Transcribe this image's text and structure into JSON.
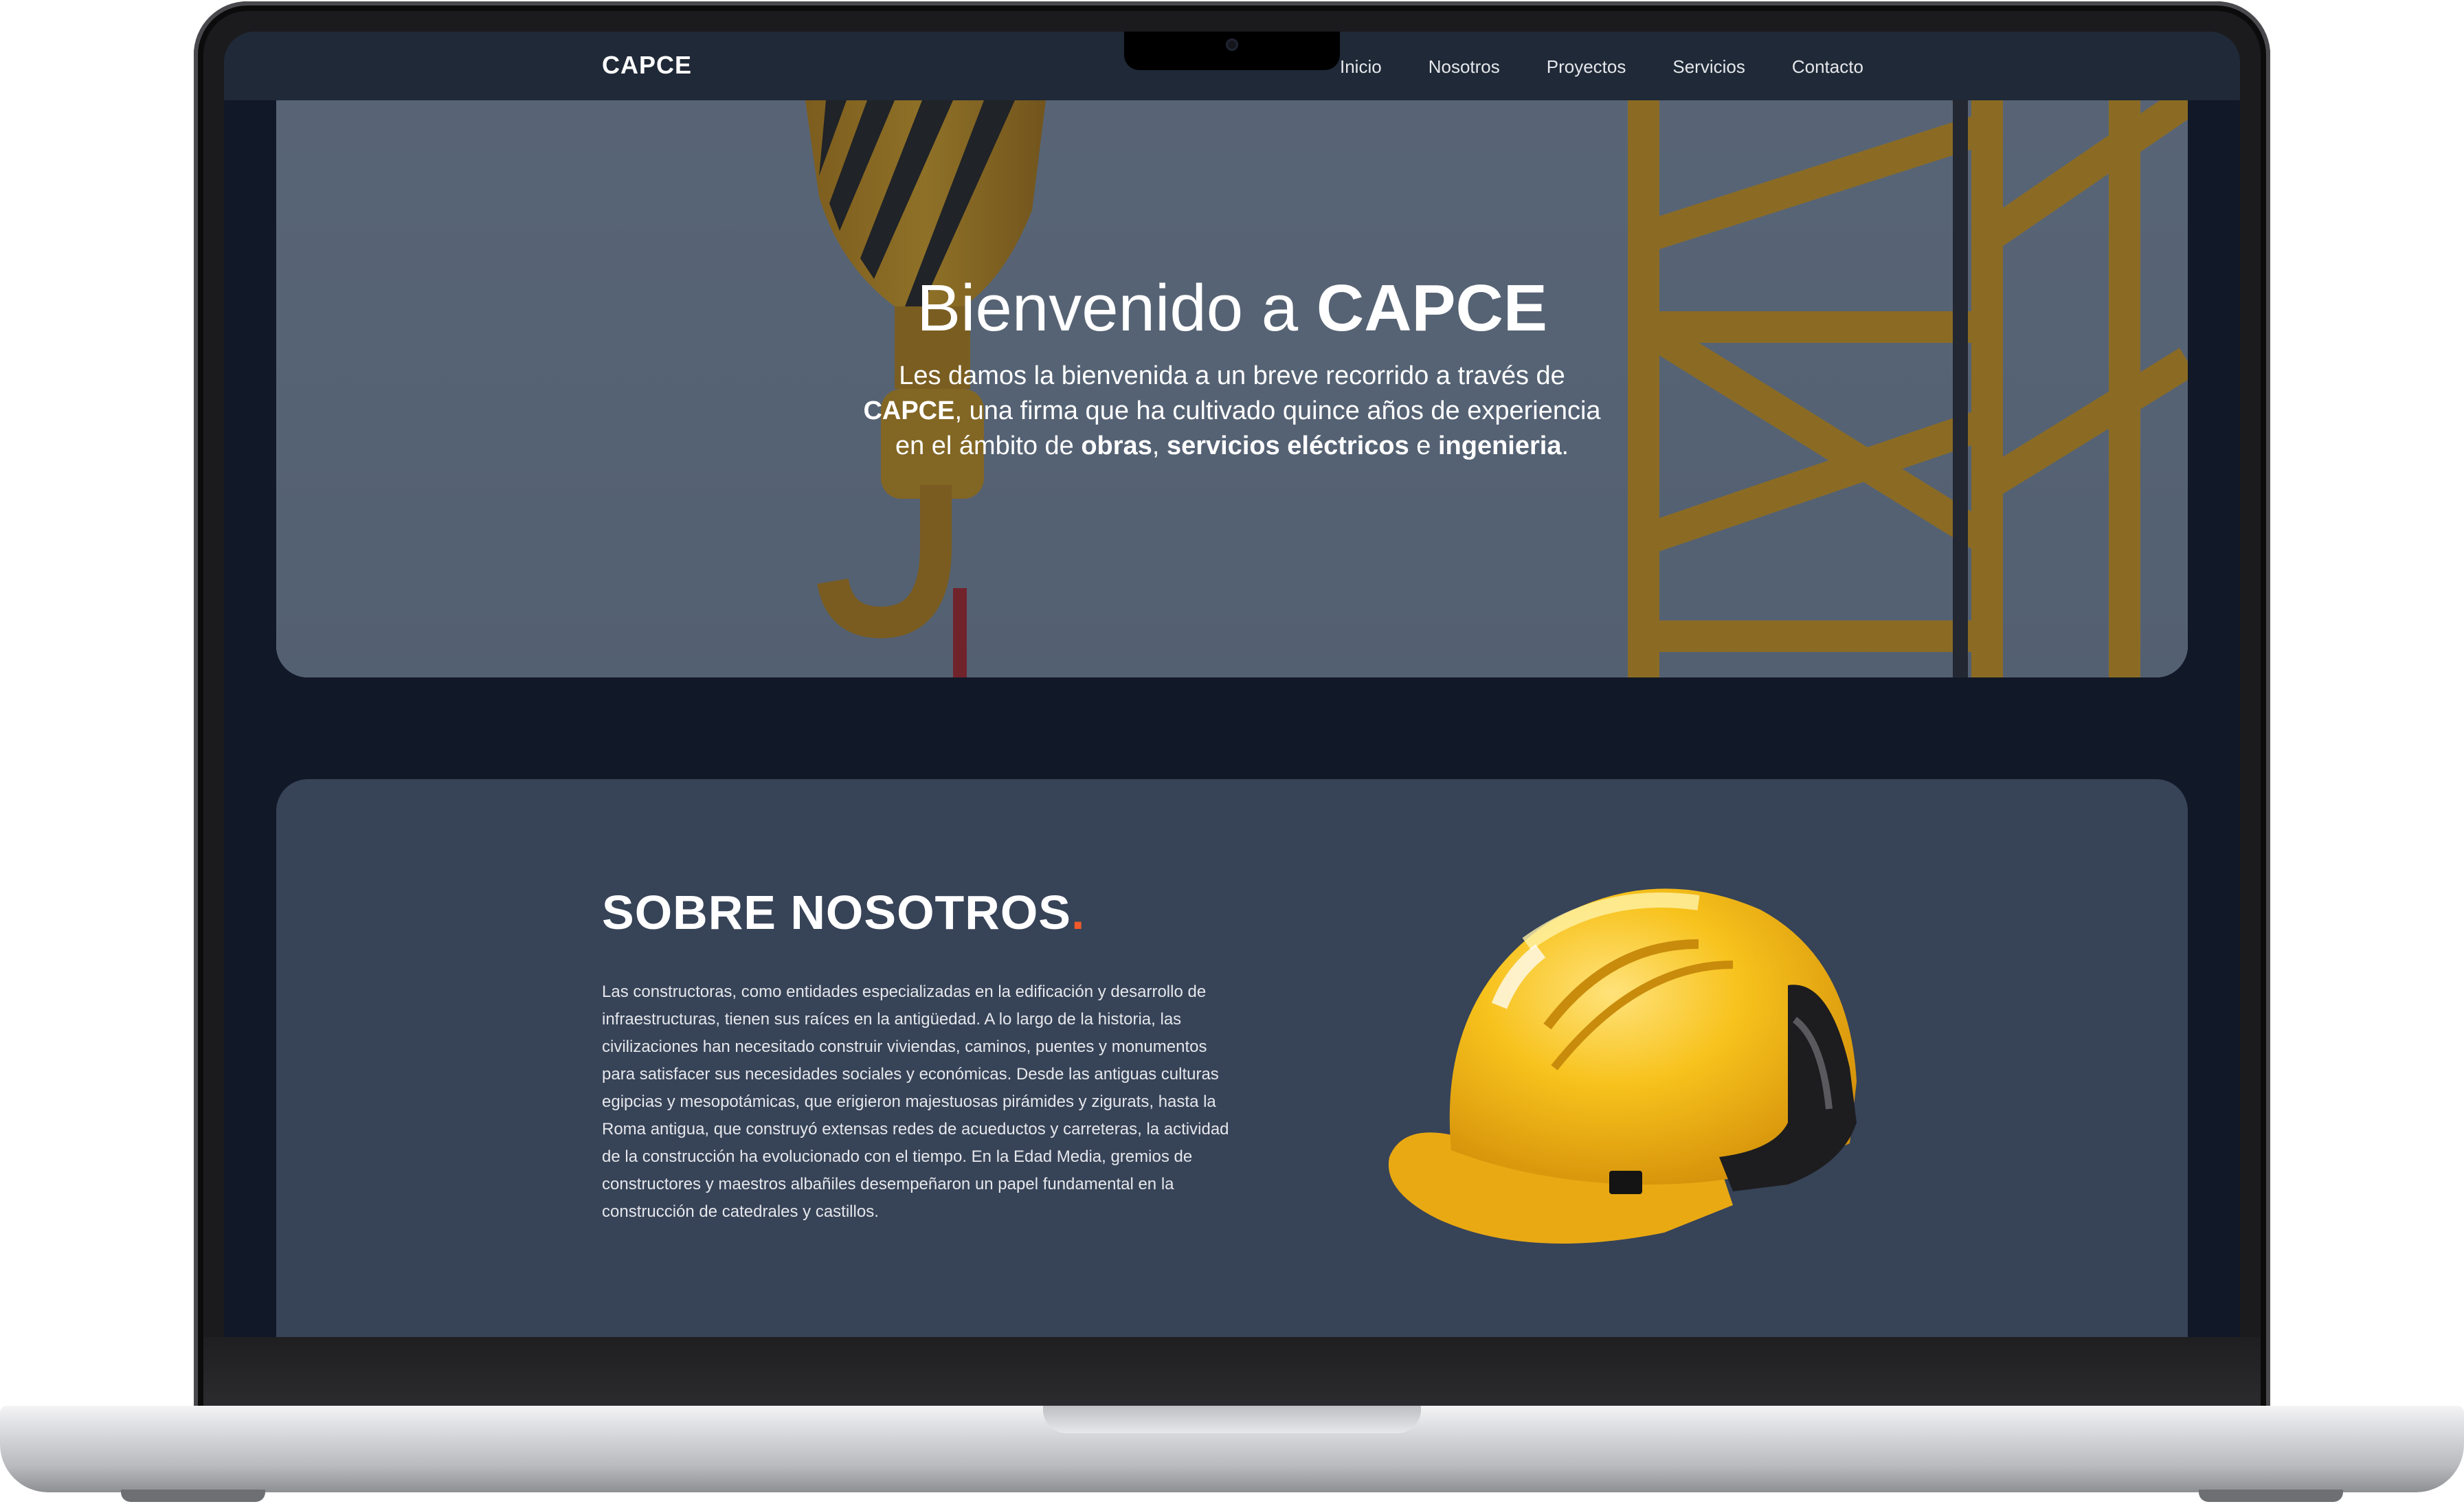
{
  "site": {
    "brand": "CAPCE",
    "nav": [
      {
        "label": "Inicio"
      },
      {
        "label": "Nosotros"
      },
      {
        "label": "Proyectos"
      },
      {
        "label": "Servicios"
      },
      {
        "label": "Contacto"
      }
    ]
  },
  "hero": {
    "title_prefix": "Bienvenido a ",
    "title_brand": "CAPCE",
    "text_1": "Les damos la bienvenida a un breve recorrido a través de ",
    "text_brand": "CAPCE",
    "text_2": ", una firma que ha cultivado quince años de experiencia en el ámbito de ",
    "text_obras": "obras",
    "text_comma": ", ",
    "text_servicios": "servicios eléctricos",
    "text_e": " e ",
    "text_ingenieria": "ingenieria",
    "text_end": "."
  },
  "about": {
    "title": "SOBRE NOSOTROS",
    "title_dot": ".",
    "paragraph": "Las constructoras, como entidades especializadas en la edificación y desarrollo de infraestructuras, tienen sus raíces en la antigüedad. A lo largo de la historia, las civilizaciones han necesitado construir viviendas, caminos, puentes y monumentos para satisfacer sus necesidades sociales y económicas. Desde las antiguas culturas egipcias y mesopotámicas, que erigieron majestuosas pirámides y zigurats, hasta la Roma antigua, que construyó extensas redes de acueductos y carreteras, la actividad de la construcción ha evolucionado con el tiempo. En la Edad Media, gremios de constructores y maestros albañiles desempeñaron un papel fundamental en la construcción de catedrales y castillos."
  },
  "colors": {
    "page_bg": "#111827",
    "navbar_bg": "#1f2937",
    "about_bg": "#374357",
    "accent_dot": "#ef5a2a",
    "crane_yellow": "#e0a21a"
  },
  "icons": {
    "hero_image": "crane-hook-and-tower-photo",
    "about_image": "yellow-hard-hat"
  }
}
